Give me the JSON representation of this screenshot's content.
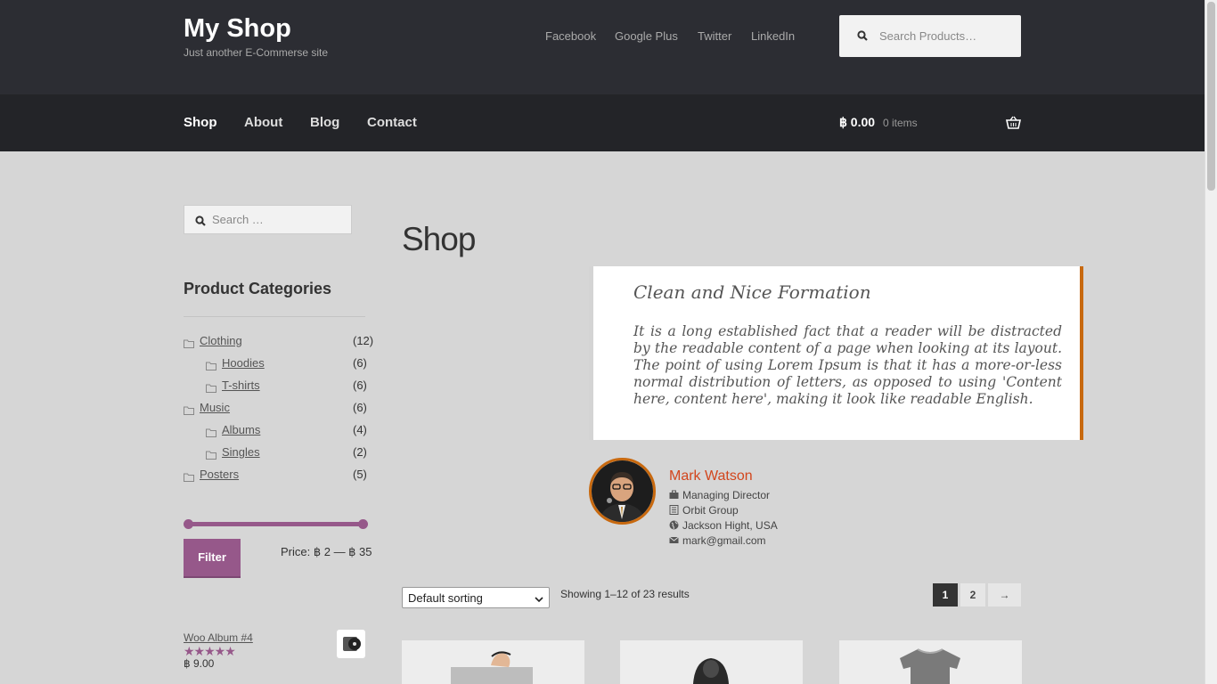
{
  "header": {
    "site_title": "My Shop",
    "site_description": "Just another E-Commerse site",
    "social_links": [
      "Facebook",
      "Google Plus",
      "Twitter",
      "LinkedIn"
    ],
    "search_placeholder": "Search Products…"
  },
  "nav": {
    "items": [
      "Shop",
      "About",
      "Blog",
      "Contact"
    ],
    "active": "Shop",
    "cart_amount": "฿ 0.00",
    "cart_items": "0 items"
  },
  "sidebar": {
    "search_placeholder": "Search …",
    "categories_heading": "Product Categories",
    "categories": [
      {
        "name": "Clothing",
        "count": "(12)",
        "level": 0
      },
      {
        "name": "Hoodies",
        "count": "(6)",
        "level": 1
      },
      {
        "name": "T-shirts",
        "count": "(6)",
        "level": 1
      },
      {
        "name": "Music",
        "count": "(6)",
        "level": 0
      },
      {
        "name": "Albums",
        "count": "(4)",
        "level": 1
      },
      {
        "name": "Singles",
        "count": "(2)",
        "level": 1
      },
      {
        "name": "Posters",
        "count": "(5)",
        "level": 0
      }
    ],
    "filter_label": "Filter",
    "price_label": "Price: ฿ 2 — ฿ 35",
    "price_range_fraction": [
      0.0,
      1.0
    ],
    "top_rated": {
      "name": "Woo Album #4",
      "stars": "★★★★★",
      "rating": 5,
      "price": "฿ 9.00"
    }
  },
  "main": {
    "title": "Shop",
    "quote_title": "Clean and Nice Formation",
    "quote_text": "It is a long established fact that a reader will be distracted by the readable content of a page when looking at its layout. The point of using Lorem Ipsum is that it has a more-or-less normal distribution of letters, as opposed to using 'Content here, content here', making it look like readable English.",
    "author": {
      "name": "Mark Watson",
      "role": "Managing Director",
      "company": "Orbit Group",
      "location": "Jackson Hight, USA",
      "email": "mark@gmail.com"
    },
    "sort_value": "Default sorting",
    "result_count": "Showing 1–12 of 23 results",
    "pagination": [
      "1",
      "2",
      "→"
    ]
  },
  "colors": {
    "accent": "#96588a",
    "quote_border": "#c8690f",
    "author_name": "#d2461d",
    "header_bg": "#2c2d33"
  }
}
